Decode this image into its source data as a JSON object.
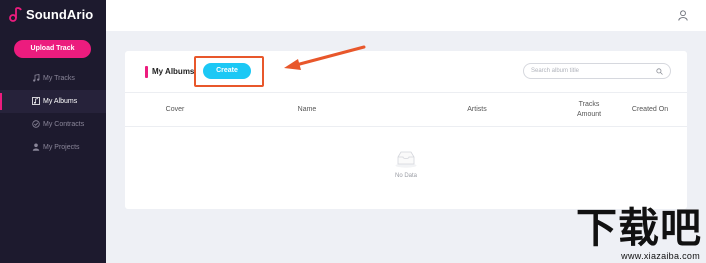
{
  "app": {
    "name": "SoundArio"
  },
  "sidebar": {
    "upload_label": "Upload Track",
    "items": [
      {
        "label": "My Tracks",
        "icon": "music-note-icon",
        "active": false
      },
      {
        "label": "My Albums",
        "icon": "album-icon",
        "active": true
      },
      {
        "label": "My Contracts",
        "icon": "contract-icon",
        "active": false
      },
      {
        "label": "My Projects",
        "icon": "user-icon",
        "active": false
      }
    ]
  },
  "header": {
    "user_icon": "user-icon"
  },
  "albums": {
    "title": "My Albums",
    "create_label": "Create",
    "search_placeholder": "Search album title",
    "columns": [
      "Cover",
      "Name",
      "Artists",
      "Tracks Amount",
      "Created On"
    ],
    "empty_text": "No Data"
  },
  "watermark": {
    "logo": "下载吧",
    "url": "www.xiazaiba.com"
  },
  "colors": {
    "accent": "#ec1c7e",
    "primary_button": "#1cc8f5",
    "sidebar_bg": "#1d1a2e",
    "annotation": "#e8572b"
  }
}
